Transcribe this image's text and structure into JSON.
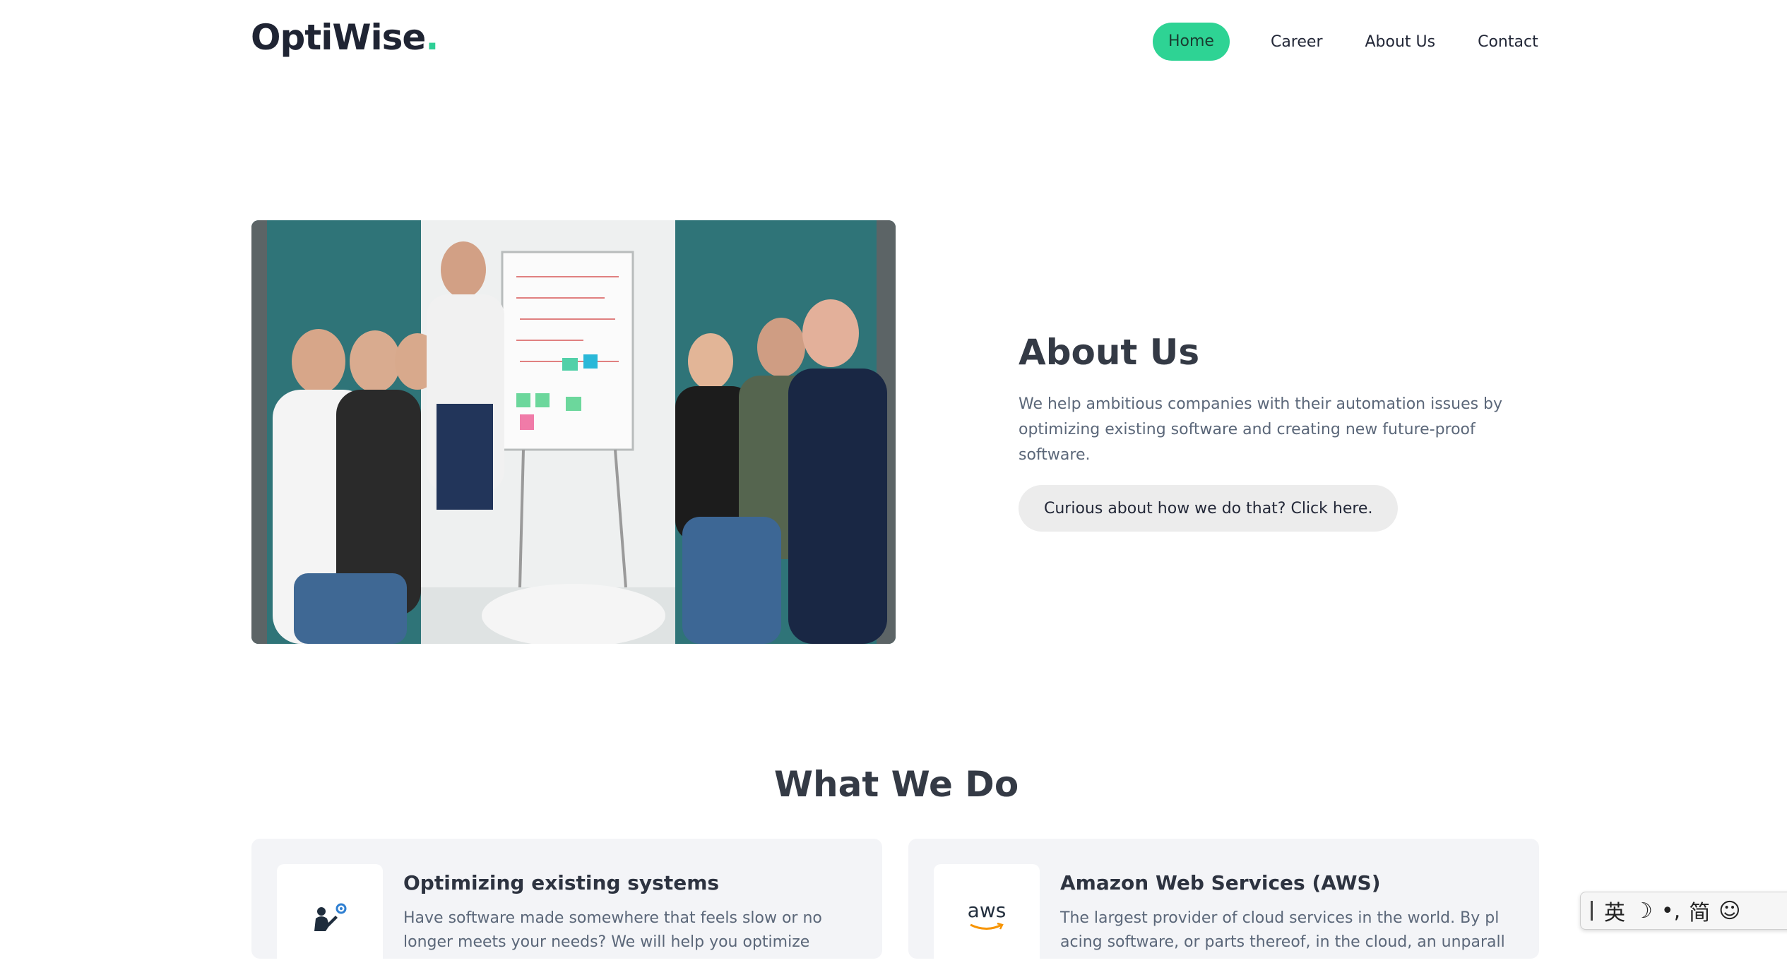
{
  "brand": {
    "name": "OptiWise",
    "dot": "."
  },
  "nav": {
    "home": "Home",
    "career": "Career",
    "about": "About Us",
    "contact": "Contact"
  },
  "about": {
    "title": "About Us",
    "text": "We help ambitious companies with their automation issues by optimizing existing software and creating new future-proof software.",
    "cta": "Curious about how we do that? Click here."
  },
  "what_we_do": {
    "title": "What We Do",
    "cards": [
      {
        "icon": "gear-person-icon",
        "title": "Optimizing existing systems",
        "text_line1": "Have software made somewhere that feels slow or no",
        "text_line2": "longer meets your needs? We will help you optimize"
      },
      {
        "icon": "aws-logo-icon",
        "logo_text": "aws",
        "title": "Amazon Web Services (AWS)",
        "text_line1": "The largest provider of cloud services in the world. By pl",
        "text_line2": "acing software, or parts thereof, in the cloud, an unparall"
      }
    ]
  },
  "ime": {
    "lang": "英",
    "moon": "☽",
    "punct": "•,",
    "simplified": "简",
    "emoji": "☺"
  },
  "colors": {
    "accent": "#2ed394",
    "heading": "#343a45",
    "body_text": "#5b6779"
  }
}
